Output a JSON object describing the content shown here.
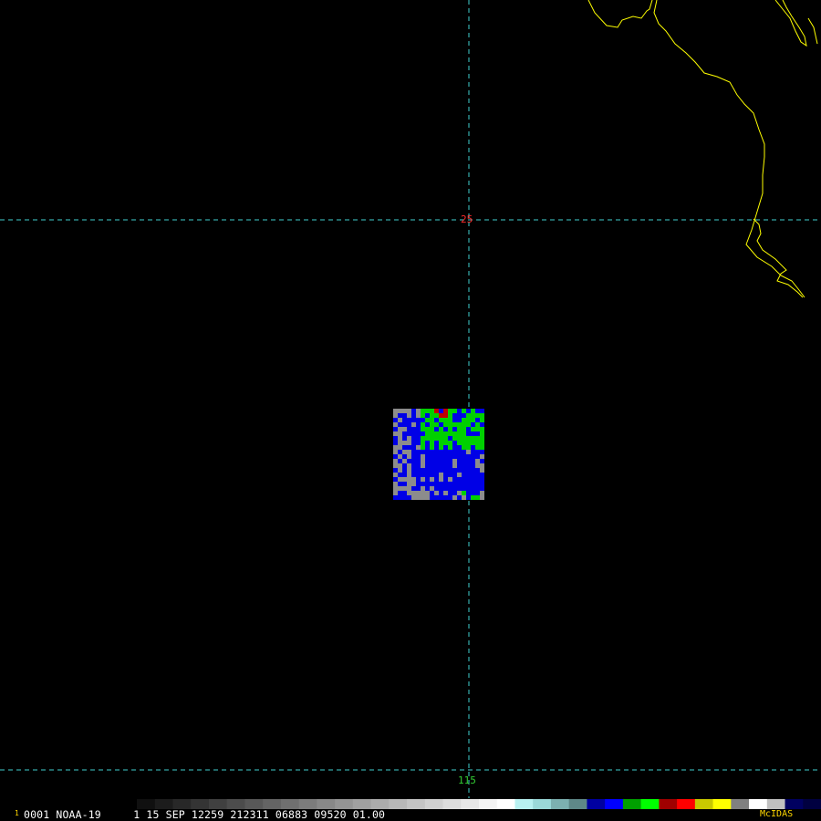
{
  "map": {
    "grid_labels": {
      "latitude": "25",
      "longitude": "115"
    },
    "colors": {
      "background": "#000000",
      "gridline": "#3fd0d0",
      "coastline": "#ffff00",
      "latitude_label": "#ff2a2a",
      "longitude_label": "#33cc33",
      "overlay_gray": "#8c8c8c",
      "overlay_blue": "#0000e6",
      "overlay_green": "#00d000",
      "overlay_red": "#c00000"
    }
  },
  "status_bar": {
    "frame_number": "1",
    "image_info": "0001 NOAA-19     1 15 SEP 12259 212311 06883 09520 01.00",
    "logo": "McIDAS"
  },
  "color_scale": {
    "segments": [
      "#101010",
      "#1c1c1c",
      "#282828",
      "#343434",
      "#404040",
      "#4c4c4c",
      "#585858",
      "#646464",
      "#707070",
      "#7c7c7c",
      "#888888",
      "#949494",
      "#a0a0a0",
      "#acacac",
      "#b8b8b8",
      "#c4c4c4",
      "#d0d0d0",
      "#dcdcdc",
      "#e8e8e8",
      "#f4f4f4",
      "#ffffff",
      "#b8f0f0",
      "#9ad8d8",
      "#7cb0b0",
      "#5e8888",
      "#0000a0",
      "#0000ff",
      "#00a000",
      "#00ff00",
      "#a00000",
      "#ff0000",
      "#c8c800",
      "#ffff00",
      "#808080",
      "#ffffff",
      "#c0c0c0",
      "#000060",
      "#000040"
    ]
  }
}
